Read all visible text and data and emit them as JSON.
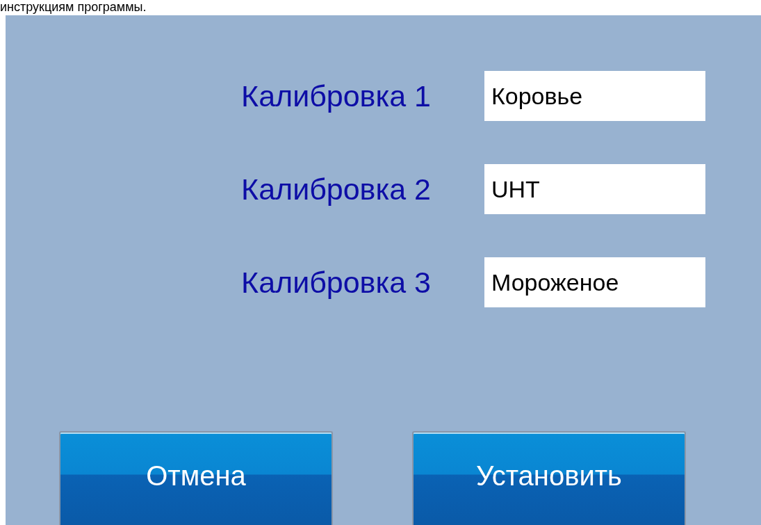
{
  "header_text": "инструкциям программы.",
  "calibrations": [
    {
      "label": "Калибровка 1",
      "value": "Коровье"
    },
    {
      "label": "Калибровка 2",
      "value": "UHT"
    },
    {
      "label": "Калибровка 3",
      "value": "Мороженое"
    }
  ],
  "buttons": [
    {
      "label": "Отмена"
    },
    {
      "label": "Установить"
    }
  ]
}
